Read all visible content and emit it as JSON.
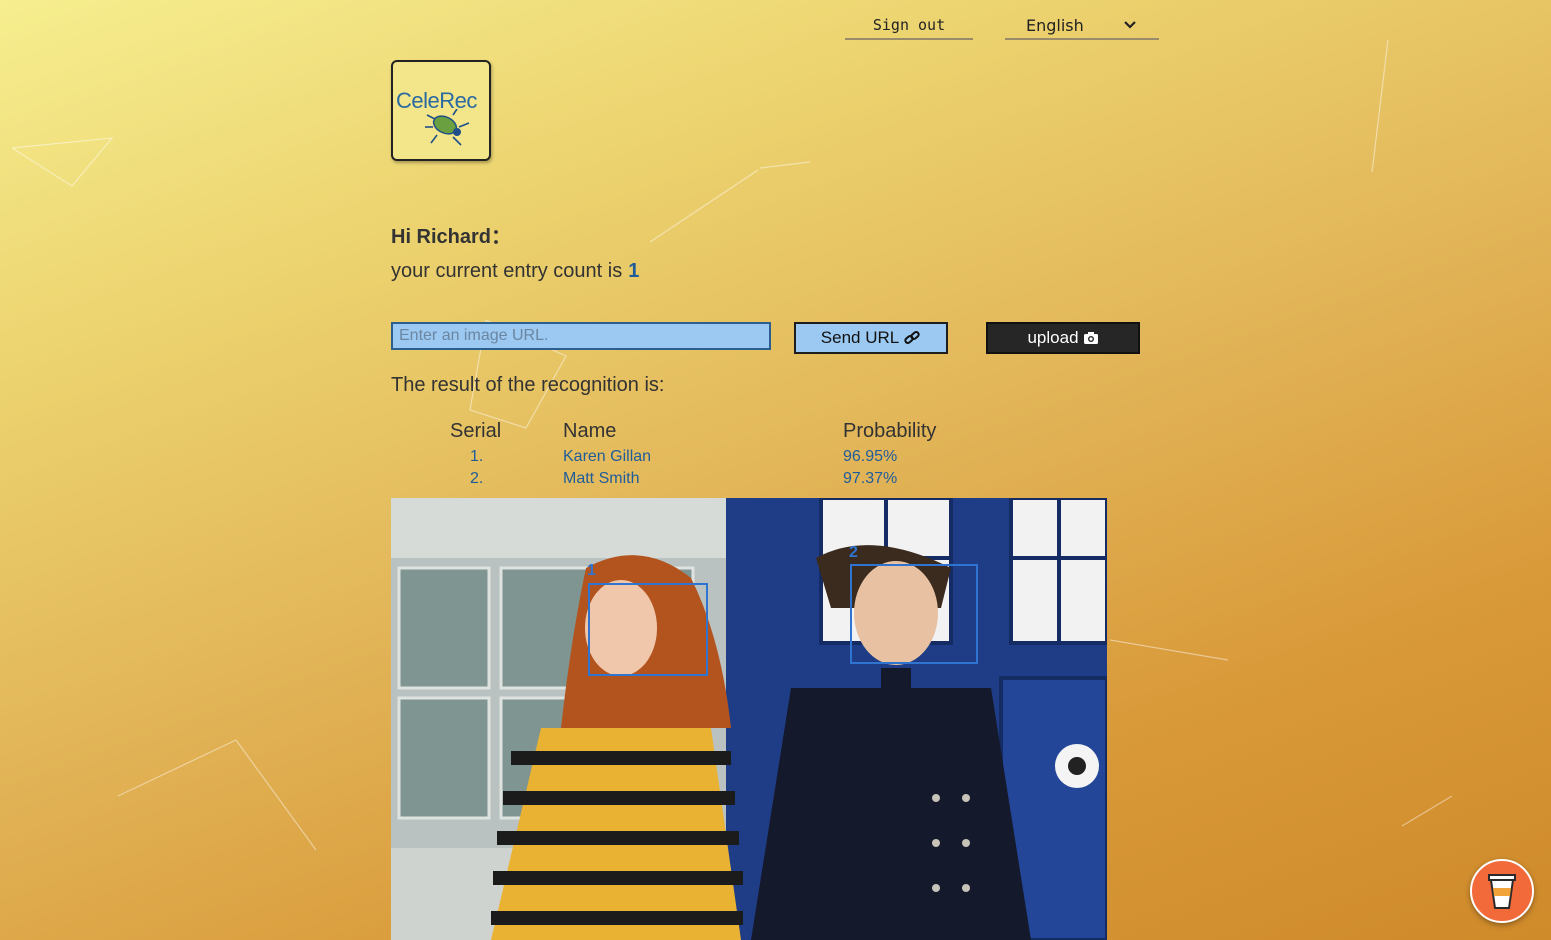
{
  "header": {
    "sign_out_label": "Sign out",
    "language_selected": "English"
  },
  "logo": {
    "text": "CeleRec",
    "icon": "bug-icon"
  },
  "greeting": {
    "text": "Hi Richard：",
    "count_prefix": "your current entry count is",
    "count_value": "1"
  },
  "form": {
    "url_placeholder": "Enter an image URL.",
    "url_value": "",
    "send_label": "Send URL",
    "send_icon": "link-icon",
    "upload_label": "upload",
    "upload_icon": "camera-icon"
  },
  "results": {
    "title": "The result of the recognition is:",
    "headers": {
      "serial": "Serial",
      "name": "Name",
      "probability": "Probability"
    },
    "rows": [
      {
        "serial": "1.",
        "name": "Karen Gillan",
        "probability": "96.95%"
      },
      {
        "serial": "2.",
        "name": "Matt Smith",
        "probability": "97.37%"
      }
    ]
  },
  "image": {
    "face_labels": [
      "1",
      "2"
    ]
  },
  "colors": {
    "accent": "#1f5d9a",
    "box": "#2f74d0",
    "input_bg": "#9cc9f2",
    "coffee": "#f26a3a"
  },
  "floating": {
    "icon": "coffee-cup-icon"
  }
}
